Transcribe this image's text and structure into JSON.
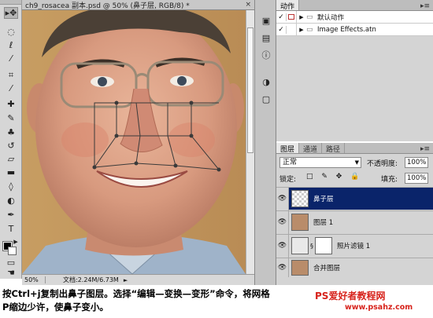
{
  "document": {
    "title": "ch9_rosacea 副本.psd @ 50% (鼻子层, RGB/8) *",
    "close_glyph": "×",
    "status_zoom": "50%",
    "status_docsize": "文档:2.24M/6.73M",
    "status_arrow": "►"
  },
  "toolbar": {
    "icons": [
      "move-icon",
      "marquee-icon",
      "lasso-icon",
      "magic-wand-icon",
      "crop-icon",
      "eyedropper-icon",
      "healing-brush-icon",
      "brush-icon",
      "clone-stamp-icon",
      "history-brush-icon",
      "eraser-icon",
      "gradient-icon",
      "blur-icon",
      "dodge-icon",
      "pen-icon",
      "type-icon",
      "path-selection-icon",
      "shape-icon",
      "hand-icon",
      "zoom-icon"
    ]
  },
  "actions_panel": {
    "tab_label": "动作",
    "menu_glyph": "▸≡",
    "rows": [
      {
        "check": "✓",
        "label": "默认动作"
      },
      {
        "check": "✓",
        "label": "Image Effects.atn"
      }
    ]
  },
  "layers_panel": {
    "tabs": [
      "图层",
      "通道",
      "路径"
    ],
    "blend_mode": "正常",
    "opacity_label": "不透明度:",
    "opacity_value": "100%",
    "lock_label": "锁定:",
    "lock_icons": "□ ✎ ✥ 🔒",
    "fill_label": "填充:",
    "fill_value": "100%",
    "layers": [
      {
        "name": "鼻子层",
        "selected": true
      },
      {
        "name": "图层 1",
        "selected": false
      },
      {
        "name": "照片滤镜 1",
        "selected": false
      },
      {
        "name": "合并图层",
        "selected": false
      }
    ]
  },
  "caption": {
    "line1": "按Ctrl+j复制出鼻子图层。选择“编辑—变换—变形”命令，将网格",
    "line2": "P缩边少许，使鼻子变小。"
  },
  "watermark": {
    "text": "PS爱好者教程网",
    "url": "www.psahz.com"
  },
  "colors": {
    "selection": "#0a246a",
    "watermark": "#d7221b"
  }
}
